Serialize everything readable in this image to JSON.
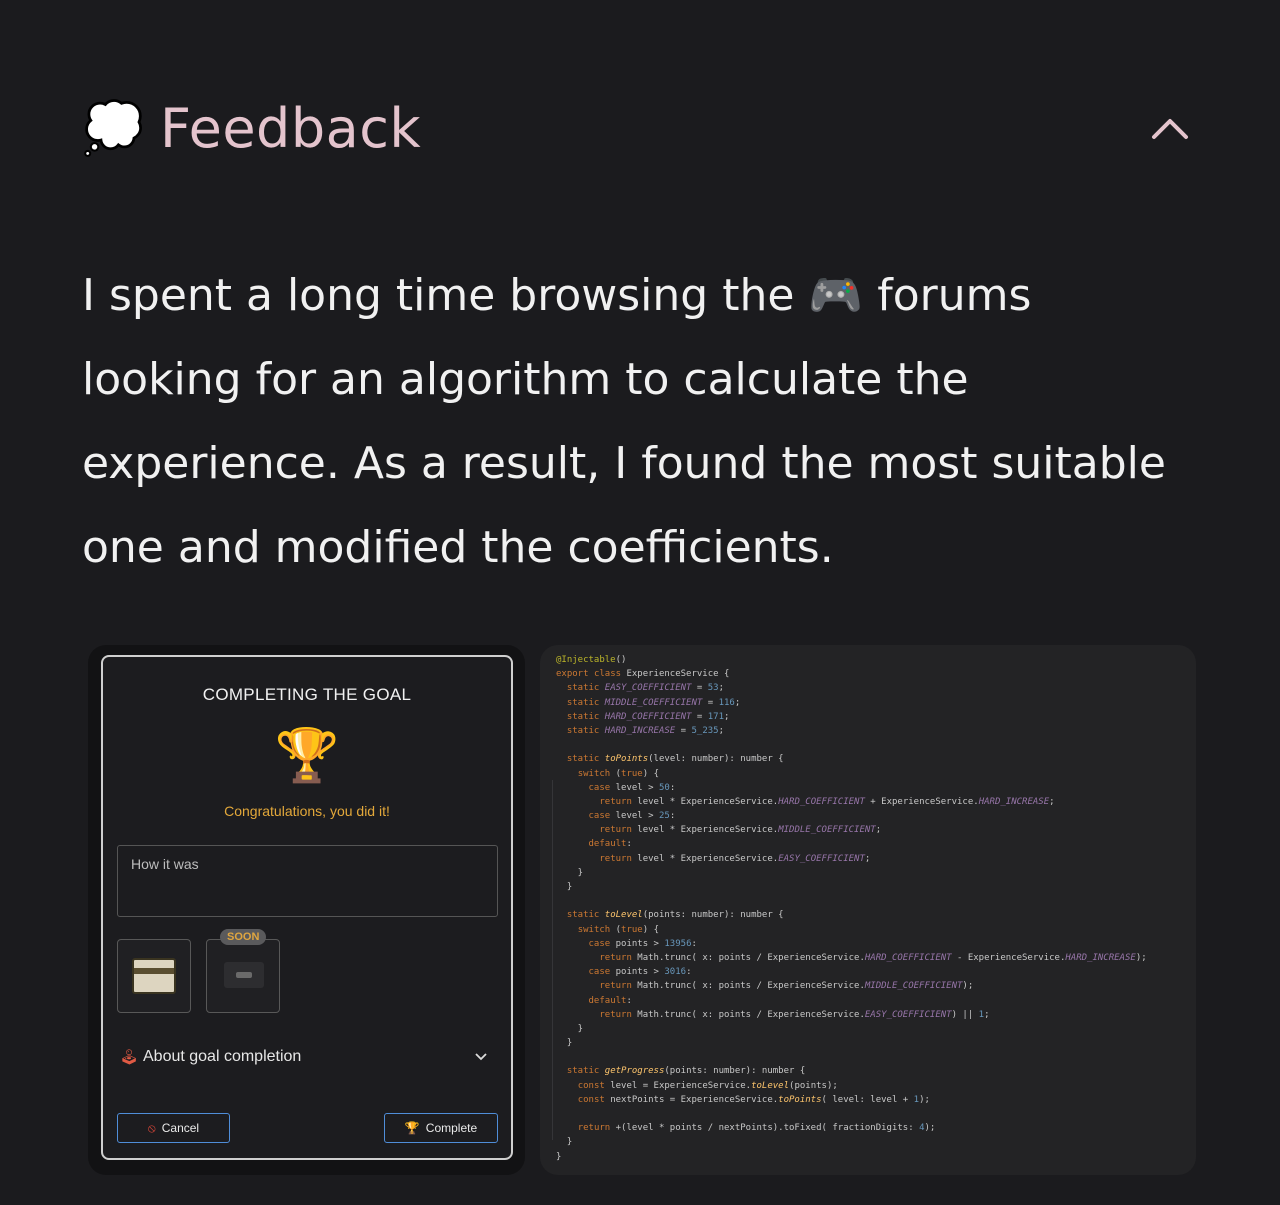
{
  "header": {
    "emoji": "💭",
    "title": "Feedback"
  },
  "body": {
    "before_emoji": "I spent a long time browsing the ",
    "emoji": "🎮",
    "after_emoji": " forums looking for an algorithm to calculate the experience. As a result, I found the most suitable one and modified the coefficients."
  },
  "dialog": {
    "title": "COMPLETING THE GOAL",
    "trophy_emoji": "🏆",
    "congrats": "Congratulations, you did it!",
    "textarea_placeholder": "How it was",
    "soon_badge": "SOON",
    "accordion_icon": "🕹",
    "accordion_label": "About goal completion",
    "cancel_icon": "⦸",
    "cancel_label": "Cancel",
    "complete_icon": "🏆",
    "complete_label": "Complete"
  },
  "code_lines": [
    "@Injectable()",
    "export class ExperienceService {",
    "  static EASY_COEFFICIENT = 53;",
    "  static MIDDLE_COEFFICIENT = 116;",
    "  static HARD_COEFFICIENT = 171;",
    "  static HARD_INCREASE = 5_235;",
    "",
    "  static toPoints(level: number): number {",
    "    switch (true) {",
    "      case level > 50:",
    "        return level * ExperienceService.HARD_COEFFICIENT + ExperienceService.HARD_INCREASE;",
    "      case level > 25:",
    "        return level * ExperienceService.MIDDLE_COEFFICIENT;",
    "      default:",
    "        return level * ExperienceService.EASY_COEFFICIENT;",
    "    }",
    "  }",
    "",
    "  static toLevel(points: number): number {",
    "    switch (true) {",
    "      case points > 13956:",
    "        return Math.trunc( x: points / ExperienceService.HARD_COEFFICIENT - ExperienceService.HARD_INCREASE);",
    "      case points > 3016:",
    "        return Math.trunc( x: points / ExperienceService.MIDDLE_COEFFICIENT);",
    "      default:",
    "        return Math.trunc( x: points / ExperienceService.EASY_COEFFICIENT) || 1;",
    "    }",
    "  }",
    "",
    "  static getProgress(points: number): number {",
    "    const level = ExperienceService.toLevel(points);",
    "    const nextPoints = ExperienceService.toPoints( level: level + 1);",
    "",
    "    return +(level * points / nextPoints).toFixed( fractionDigits: 4);",
    "  }",
    "}"
  ],
  "colors": {
    "title": "#e4c4cd",
    "congrats": "#e3a83a",
    "button_border": "#4f8dd8",
    "keyword": "#cc7832",
    "field": "#9876aa",
    "number": "#6897bb"
  }
}
